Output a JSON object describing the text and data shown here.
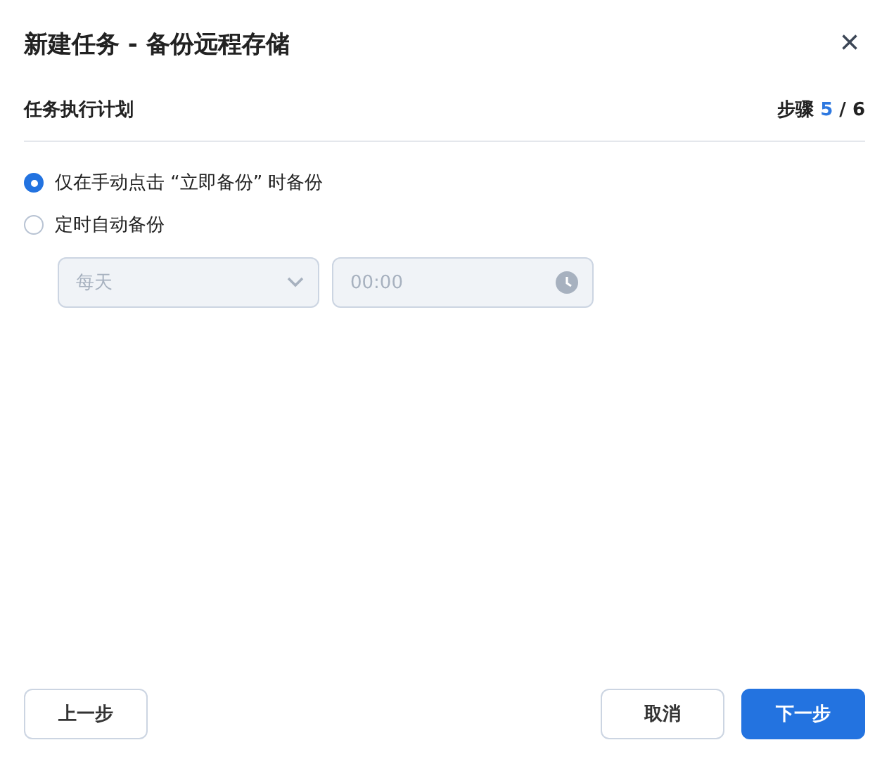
{
  "dialog": {
    "title": "新建任务 - 备份远程存储",
    "close": "×"
  },
  "section": {
    "title": "任务执行计划",
    "step": {
      "label": "步骤",
      "current": "5",
      "separator": "/",
      "total": "6"
    }
  },
  "options": [
    {
      "label": "仅在手动点击 “立即备份” 时备份",
      "selected": true
    },
    {
      "label": "定时自动备份",
      "selected": false
    }
  ],
  "schedule": {
    "disabled": true,
    "frequency": "每天",
    "time": "00:00"
  },
  "buttons": {
    "back": "上一步",
    "cancel": "取消",
    "next": "下一步"
  }
}
